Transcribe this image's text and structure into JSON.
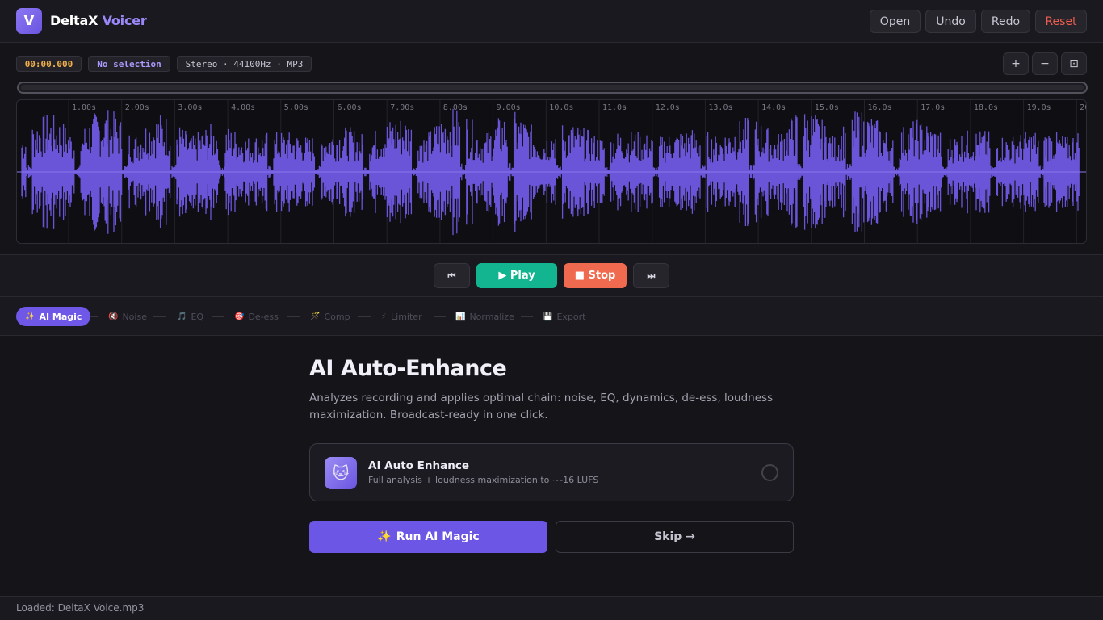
{
  "app": {
    "logo_letter": "V",
    "name_part1": "DeltaX",
    "name_part2": "Voicer"
  },
  "header": {
    "open_label": "Open",
    "undo_label": "Undo",
    "redo_label": "Redo",
    "reset_label": "Reset"
  },
  "toolbar": {
    "time": "00:00.000",
    "selection": "No selection",
    "format": "Stereo · 44100Hz · MP3",
    "zoom_in": "+",
    "zoom_out": "−",
    "fit": "⊡"
  },
  "waveform": {
    "color": "#6a55d8",
    "ruler_labels": [
      "1.00s",
      "2.00s",
      "3.00s",
      "4.00s",
      "5.00s",
      "6.00s",
      "7.00s",
      "8.00s",
      "9.00s",
      "10.0s",
      "11.0s",
      "12.0s",
      "13.0s",
      "14.0s",
      "15.0s",
      "16.0s",
      "17.0s",
      "18.0s",
      "19.0s",
      "20"
    ]
  },
  "transport": {
    "rewind_icon": "⏮",
    "play_label": "▶ Play",
    "stop_label": "■ Stop",
    "forward_icon": "⏭"
  },
  "steps": [
    {
      "icon": "✨",
      "label": "AI Magic"
    },
    {
      "icon": "🔇",
      "label": "Noise"
    },
    {
      "icon": "🎵",
      "label": "EQ"
    },
    {
      "icon": "🎯",
      "label": "De-ess"
    },
    {
      "icon": "🪄",
      "label": "Comp"
    },
    {
      "icon": "⚡",
      "label": "Limiter"
    },
    {
      "icon": "📊",
      "label": "Normalize"
    },
    {
      "icon": "💾",
      "label": "Export"
    }
  ],
  "main": {
    "title": "AI Auto-Enhance",
    "description": "Analyzes recording and applies optimal chain: noise, EQ, dynamics, de-ess, loudness maximization. Broadcast-ready in one click.",
    "card": {
      "icon": "🐱",
      "title": "AI Auto Enhance",
      "subtitle": "Full analysis + loudness maximization to ~-16 LUFS"
    },
    "run_icon": "✨",
    "run_label": "Run AI Magic",
    "skip_label": "Skip →"
  },
  "status": {
    "text": "Loaded: DeltaX Voice.mp3"
  },
  "colors": {
    "accent": "#6b56e5",
    "play": "#12b58f",
    "stop": "#f06a4f",
    "reset": "#ee5d4f",
    "time": "#f2b04b"
  }
}
